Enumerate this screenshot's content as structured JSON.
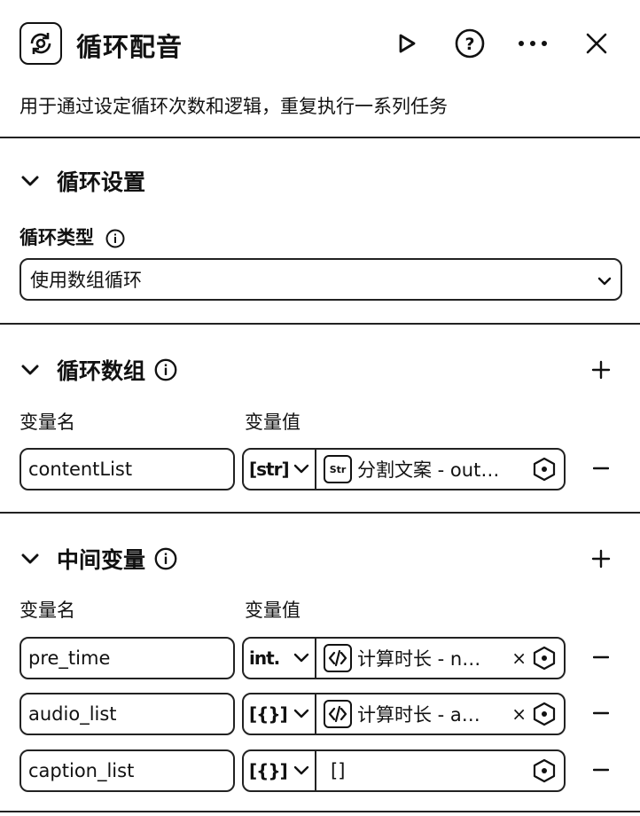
{
  "header": {
    "title": "循环配音",
    "logo_icon": "loop-icon",
    "actions": [
      "run-icon",
      "help-icon",
      "more-icon",
      "close-icon"
    ]
  },
  "description": "用于通过设定循环次数和逻辑，重复执行一系列任务",
  "loop_settings": {
    "title": "循环设置",
    "type_label": "循环类型",
    "type_value": "使用数组循环"
  },
  "loop_array": {
    "title": "循环数组",
    "col_name": "变量名",
    "col_value": "变量值",
    "rows": [
      {
        "name": "contentList",
        "type": "[str]",
        "ref_icon": "Str",
        "value": "分割文案 - out…"
      }
    ]
  },
  "intermediate": {
    "title": "中间变量",
    "col_name": "变量名",
    "col_value": "变量值",
    "rows": [
      {
        "name": "pre_time",
        "type": "int.",
        "value": "计算时长 - n…",
        "has_ref": true,
        "clear": "×"
      },
      {
        "name": "audio_list",
        "type": "[{}]",
        "value": "计算时长 - a…",
        "has_ref": true,
        "clear": "×"
      },
      {
        "name": "caption_list",
        "type": "[{}]",
        "value": "[]",
        "has_ref": false
      }
    ]
  }
}
